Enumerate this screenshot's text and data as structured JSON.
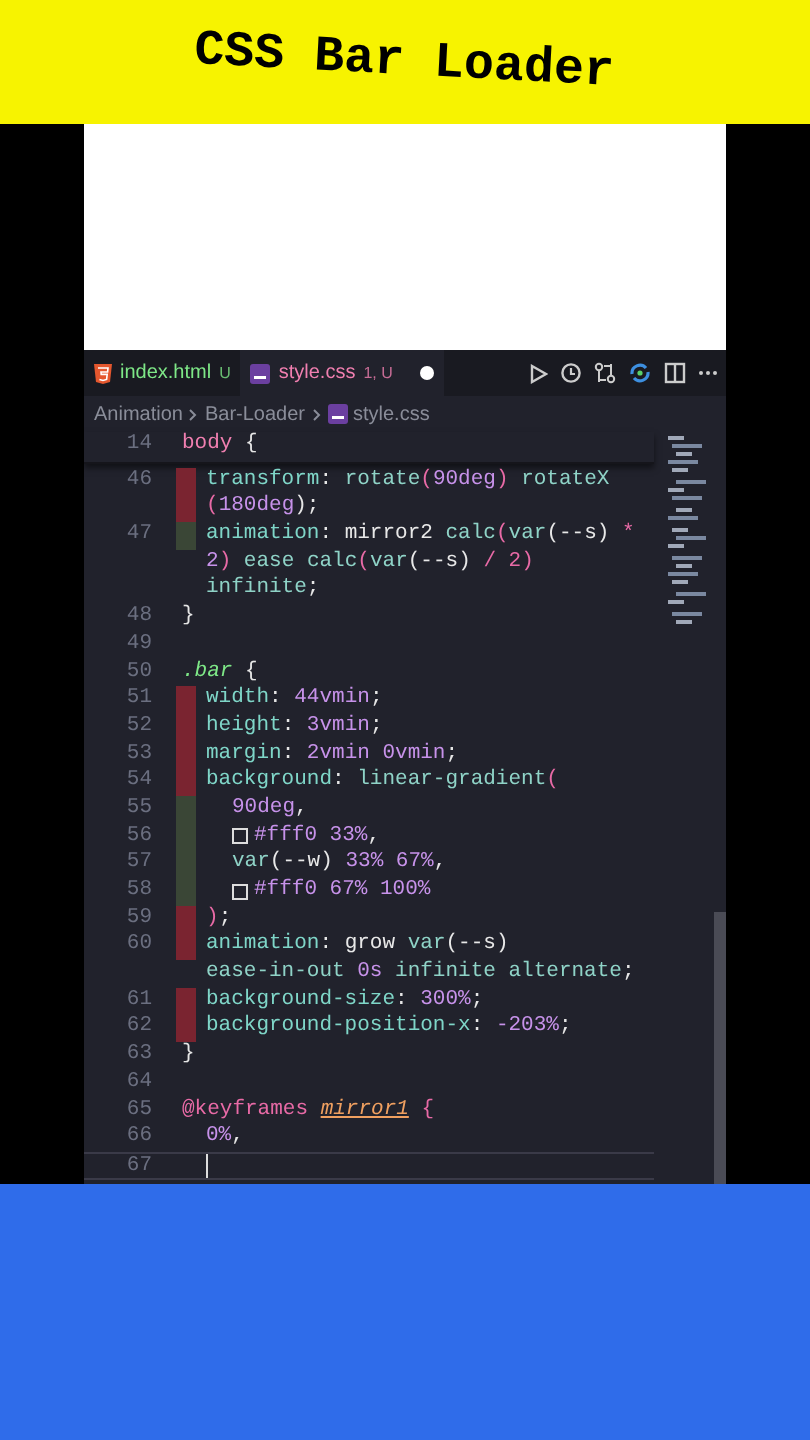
{
  "banner": {
    "title": "CSS Bar Loader"
  },
  "tabs": [
    {
      "label": "index.html",
      "badge": "U",
      "kind": "html",
      "selected": false,
      "modified": false
    },
    {
      "label": "style.css",
      "badge": "1, U",
      "kind": "css",
      "selected": true,
      "modified": true
    }
  ],
  "breadcrumb": [
    {
      "label": "Animation",
      "kind": "folder"
    },
    {
      "label": "Bar-Loader",
      "kind": "folder"
    },
    {
      "label": "style.css",
      "kind": "css"
    }
  ],
  "sticky": {
    "number": "14",
    "kind": "top",
    "segments": [
      {
        "t": "body",
        "kind": "tag"
      },
      {
        "t": " {",
        "kind": "punct"
      }
    ]
  },
  "lines": [
    {
      "number": "46",
      "kind": "nested",
      "color": "#7a2430",
      "segments": [
        {
          "t": "transform",
          "kind": "prop"
        },
        {
          "t": ": ",
          "kind": "punct"
        },
        {
          "t": "rotate",
          "kind": "fn"
        },
        {
          "t": "(",
          "kind": "brace"
        },
        {
          "t": "90deg",
          "kind": "num"
        },
        {
          "t": ") ",
          "kind": "brace"
        },
        {
          "t": "rotateX",
          "kind": "fn"
        }
      ]
    },
    {
      "kind": "nested",
      "color": "#7a2430",
      "segments": [
        {
          "t": "(",
          "kind": "brace"
        },
        {
          "t": "180deg",
          "kind": "num"
        },
        {
          "t": ");",
          "kind": "punct"
        }
      ]
    },
    {
      "number": "47",
      "kind": "nested",
      "color": "#3a4636",
      "segments": [
        {
          "t": "animation",
          "kind": "prop"
        },
        {
          "t": ": ",
          "kind": "punct"
        },
        {
          "t": "mirror2 ",
          "kind": "text"
        },
        {
          "t": "calc",
          "kind": "fn"
        },
        {
          "t": "(",
          "kind": "brace"
        },
        {
          "t": "var",
          "kind": "fn"
        },
        {
          "t": "(--s) ",
          "kind": "text"
        },
        {
          "t": "*",
          "kind": "op"
        }
      ]
    },
    {
      "kind": "nested",
      "segments": [
        {
          "t": "2",
          "kind": "num"
        },
        {
          "t": ") ",
          "kind": "brace"
        },
        {
          "t": "ease ",
          "kind": "fn"
        },
        {
          "t": "calc",
          "kind": "fn"
        },
        {
          "t": "(",
          "kind": "brace"
        },
        {
          "t": "var",
          "kind": "fn"
        },
        {
          "t": "(--s) ",
          "kind": "text"
        },
        {
          "t": "/ 2",
          "kind": "op"
        },
        {
          "t": ")",
          "kind": "brace"
        }
      ]
    },
    {
      "kind": "nested",
      "segments": [
        {
          "t": "infinite",
          "kind": "fn"
        },
        {
          "t": ";",
          "kind": "punct"
        }
      ]
    },
    {
      "number": "48",
      "kind": "top",
      "segments": [
        {
          "t": "}",
          "kind": "punct"
        }
      ]
    },
    {
      "number": "49",
      "kind": "top"
    },
    {
      "number": "50",
      "kind": "top",
      "segments": [
        {
          "t": ".bar",
          "kind": "selector"
        },
        {
          "t": " {",
          "kind": "punct"
        }
      ]
    },
    {
      "number": "51",
      "kind": "nested",
      "color": "#7a2430",
      "segments": [
        {
          "t": "width",
          "kind": "prop"
        },
        {
          "t": ": ",
          "kind": "punct"
        },
        {
          "t": "44vmin",
          "kind": "num"
        },
        {
          "t": ";",
          "kind": "punct"
        }
      ]
    },
    {
      "number": "52",
      "kind": "nested",
      "color": "#7a2430",
      "segments": [
        {
          "t": "height",
          "kind": "prop"
        },
        {
          "t": ": ",
          "kind": "punct"
        },
        {
          "t": "3vmin",
          "kind": "num"
        },
        {
          "t": ";",
          "kind": "punct"
        }
      ]
    },
    {
      "number": "53",
      "kind": "nested",
      "color": "#7a2430",
      "segments": [
        {
          "t": "margin",
          "kind": "prop"
        },
        {
          "t": ": ",
          "kind": "punct"
        },
        {
          "t": "2vmin 0vmin",
          "kind": "num"
        },
        {
          "t": ";",
          "kind": "punct"
        }
      ]
    },
    {
      "number": "54",
      "kind": "nested",
      "color": "#7a2430",
      "segments": [
        {
          "t": "background",
          "kind": "prop"
        },
        {
          "t": ": ",
          "kind": "punct"
        },
        {
          "t": "linear-gradient",
          "kind": "fn"
        },
        {
          "t": "(",
          "kind": "brace"
        }
      ]
    },
    {
      "number": "55",
      "kind": "deep",
      "color": "#3a4636",
      "segments": [
        {
          "t": "90deg",
          "kind": "num"
        },
        {
          "t": ",",
          "kind": "punct"
        }
      ]
    },
    {
      "number": "56",
      "kind": "deep",
      "color": "#3a4636",
      "segments": [
        {
          "kind": "swatch"
        },
        {
          "t": "#fff0 33%",
          "kind": "num"
        },
        {
          "t": ",",
          "kind": "punct"
        }
      ]
    },
    {
      "number": "57",
      "kind": "deep",
      "color": "#3a4636",
      "segments": [
        {
          "t": "var",
          "kind": "fn"
        },
        {
          "t": "(--w) ",
          "kind": "text"
        },
        {
          "t": "33% 67%",
          "kind": "num"
        },
        {
          "t": ",",
          "kind": "punct"
        }
      ]
    },
    {
      "number": "58",
      "kind": "deep",
      "color": "#3a4636",
      "segments": [
        {
          "kind": "swatch"
        },
        {
          "t": "#fff0 67% 100%",
          "kind": "num"
        }
      ]
    },
    {
      "number": "59",
      "kind": "nested",
      "color": "#7a2430",
      "segments": [
        {
          "t": ")",
          "kind": "brace"
        },
        {
          "t": ";",
          "kind": "punct"
        }
      ]
    },
    {
      "number": "60",
      "kind": "nested",
      "color": "#7a2430",
      "segments": [
        {
          "t": "animation",
          "kind": "prop"
        },
        {
          "t": ": ",
          "kind": "punct"
        },
        {
          "t": "grow ",
          "kind": "text"
        },
        {
          "t": "var",
          "kind": "fn"
        },
        {
          "t": "(--s)",
          "kind": "text"
        }
      ]
    },
    {
      "kind": "nested",
      "segments": [
        {
          "t": "ease-in-out ",
          "kind": "fn"
        },
        {
          "t": "0s ",
          "kind": "num"
        },
        {
          "t": "infinite alternate",
          "kind": "fn"
        },
        {
          "t": ";",
          "kind": "punct"
        }
      ]
    },
    {
      "number": "61",
      "kind": "nested",
      "color": "#7a2430",
      "segments": [
        {
          "t": "background-size",
          "kind": "prop"
        },
        {
          "t": ": ",
          "kind": "punct"
        },
        {
          "t": "300%",
          "kind": "num"
        },
        {
          "t": ";",
          "kind": "punct"
        }
      ]
    },
    {
      "number": "62",
      "kind": "nested",
      "color": "#7a2430",
      "segments": [
        {
          "t": "background-position-x",
          "kind": "prop"
        },
        {
          "t": ": ",
          "kind": "punct"
        },
        {
          "t": "-203%",
          "kind": "num"
        },
        {
          "t": ";",
          "kind": "punct"
        }
      ]
    },
    {
      "number": "63",
      "kind": "top",
      "segments": [
        {
          "t": "}",
          "kind": "punct"
        }
      ]
    },
    {
      "number": "64",
      "kind": "top"
    },
    {
      "number": "65",
      "kind": "top",
      "segments": [
        {
          "t": "@keyframes ",
          "kind": "at"
        },
        {
          "t": "mirror1",
          "kind": "name"
        },
        {
          "t": " {",
          "kind": "brace"
        }
      ]
    },
    {
      "number": "66",
      "kind": "nested",
      "segments": [
        {
          "t": "0%",
          "kind": "num"
        },
        {
          "t": ",",
          "kind": "punct"
        }
      ]
    },
    {
      "number": "67",
      "kind": "nested",
      "cursor": true
    }
  ]
}
